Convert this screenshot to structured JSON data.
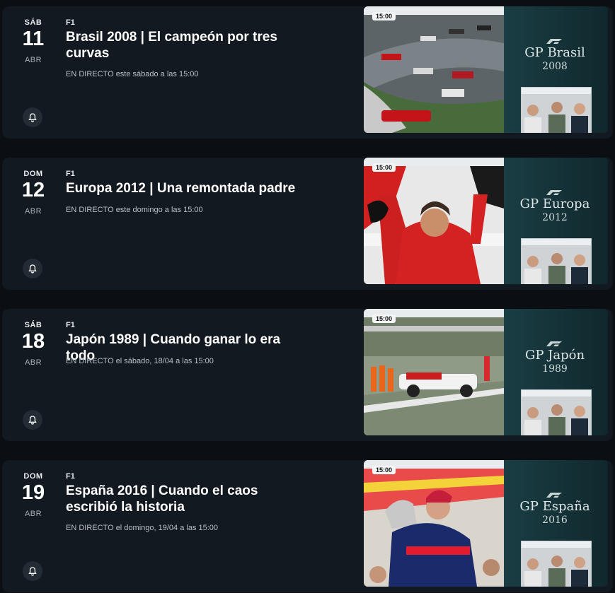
{
  "events": [
    {
      "dow": "SÁB",
      "day": "11",
      "month": "ABR",
      "sport": "F1",
      "title": "Brasil 2008 | El campeón por tres curvas",
      "status": "EN DIRECTO este sábado a las 15:00",
      "time": "15:00",
      "gp_name": "GP Brasil",
      "gp_year": "2008",
      "bell_icon": "bell-icon"
    },
    {
      "dow": "DOM",
      "day": "12",
      "month": "ABR",
      "sport": "F1",
      "title": "Europa 2012 | Una remontada padre",
      "status": "EN DIRECTO este domingo a las 15:00",
      "time": "15:00",
      "gp_name": "GP Europa",
      "gp_year": "2012",
      "bell_icon": "bell-icon"
    },
    {
      "dow": "SÁB",
      "day": "18",
      "month": "ABR",
      "sport": "F1",
      "title": "Japón 1989 | Cuando ganar lo era todo",
      "status": "EN DIRECTO el sábado, 18/04 a las 15:00",
      "time": "15:00",
      "gp_name": "GP Japón",
      "gp_year": "1989",
      "bell_icon": "bell-icon"
    },
    {
      "dow": "DOM",
      "day": "19",
      "month": "ABR",
      "sport": "F1",
      "title": "España 2016 | Cuando el caos escribió la historia",
      "status": "EN DIRECTO el domingo, 19/04 a las 15:00",
      "time": "15:00",
      "gp_name": "GP España",
      "gp_year": "2016",
      "bell_icon": "bell-icon"
    }
  ],
  "colors": {
    "background": "#0b0f13",
    "card": "#121920",
    "thumb_bg": "#1a3f45"
  }
}
